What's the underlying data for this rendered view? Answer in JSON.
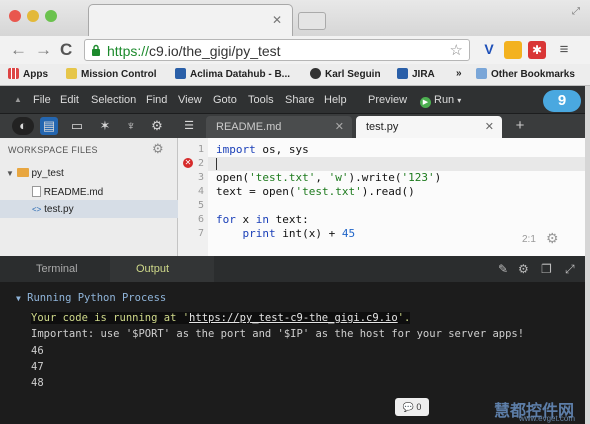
{
  "browser": {
    "tab_title": "",
    "url_prefix": "https://",
    "url_host": "c9.io",
    "url_path": "/the_gigi/py_test",
    "bookmarks": [
      "Apps",
      "Mission Control",
      "Aclima Datahub - B...",
      "Karl Seguin",
      "JIRA",
      "»",
      "Other Bookmarks"
    ]
  },
  "ide": {
    "menus": [
      "File",
      "Edit",
      "Selection",
      "Find",
      "View",
      "Goto",
      "Tools",
      "Share",
      "Help"
    ],
    "preview_label": "Preview",
    "run_label": "Run",
    "tabs": {
      "readme": "README.md",
      "test": "test.py"
    },
    "workspace_header": "WORKSPACE FILES",
    "tree": {
      "folder": "py_test",
      "file1": "README.md",
      "file2": "test.py"
    },
    "line_numbers": [
      "1",
      "2",
      "3",
      "4",
      "5",
      "6",
      "7"
    ],
    "cursor_position": "2:1",
    "panel_tabs": {
      "terminal": "Terminal",
      "output": "Output"
    },
    "console": {
      "process_title": "Running Python Process",
      "line_running_prefix": "Your code is running at '",
      "line_running_url": "https://py_test-c9-the_gigi.c9.io",
      "line_running_suffix": "'.",
      "line_important": "Important: use '$PORT' as the port and '$IP' as the host for your server apps!",
      "out1": "46",
      "out2": "47",
      "out3": "48"
    },
    "chat_count": "0"
  },
  "code": {
    "l1_kw": "import",
    "l1_rest": " os, sys",
    "l3_a": "open(",
    "l3_s1": "'test.txt'",
    "l3_b": ", ",
    "l3_s2": "'w'",
    "l3_c": ").write(",
    "l3_s3": "'123'",
    "l3_d": ")",
    "l4_a": "text = open(",
    "l4_s": "'test.txt'",
    "l4_b": ").read()",
    "l6_for": "for",
    "l6_x": " x ",
    "l6_in": "in",
    "l6_rest": " text:",
    "l7_indent": "    ",
    "l7_print": "print",
    "l7_mid": " int(x) + ",
    "l7_num": "45"
  },
  "watermark": {
    "text": "慧都控件网",
    "sub": "www.evget.com"
  },
  "colors": {
    "accent_green": "#1c8a2c",
    "ide_dark": "#2f3132",
    "output_yellow": "#cfd98a",
    "error_red": "#d62b2b",
    "c9_blue": "#4aa8e0"
  }
}
